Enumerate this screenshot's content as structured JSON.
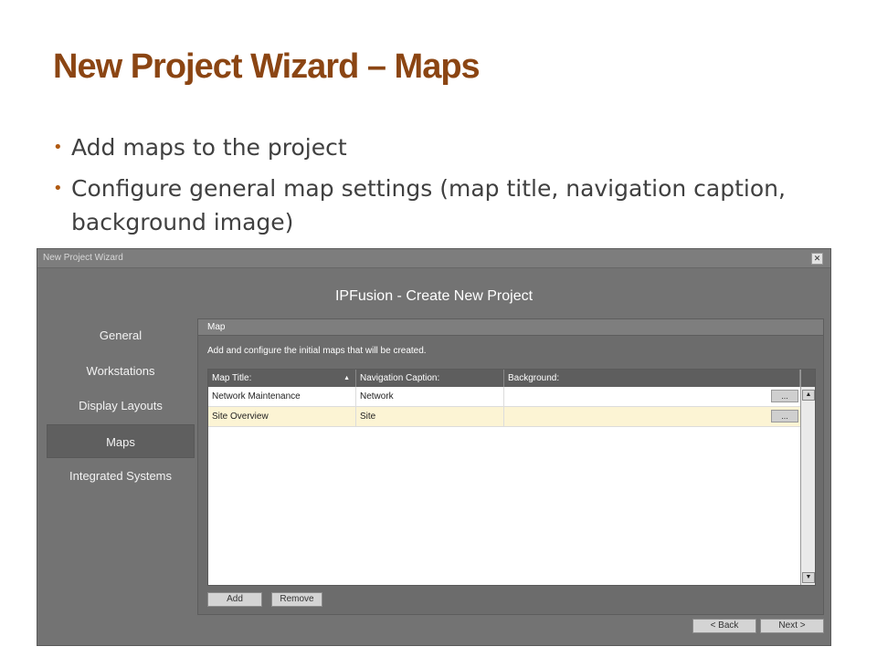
{
  "slide": {
    "title": "New Project Wizard – Maps",
    "bullets": [
      "Add maps to the project",
      "Configure general map settings (map title, navigation caption, background image)"
    ]
  },
  "window": {
    "title": "New Project Wizard",
    "close_glyph": "✕",
    "app_title": "IPFusion - Create New Project"
  },
  "nav": {
    "items": [
      {
        "label": "General"
      },
      {
        "label": "Workstations"
      },
      {
        "label": "Display Layouts"
      },
      {
        "label": "Maps",
        "active": true
      },
      {
        "label": "Integrated Systems"
      }
    ]
  },
  "panel": {
    "header": "Map",
    "description": "Add and configure the initial maps that will be created."
  },
  "grid": {
    "columns": [
      "Map Title:",
      "Navigation Caption:",
      "Background:"
    ],
    "sort_indicator": "▲",
    "ellipsis": "...",
    "scroll_up": "▲",
    "scroll_down": "▼",
    "rows": [
      {
        "title": "Network Maintenance",
        "caption": "Network",
        "background": ""
      },
      {
        "title": "Site Overview",
        "caption": "Site",
        "background": "",
        "selected": true
      }
    ]
  },
  "buttons": {
    "add": "Add",
    "remove": "Remove",
    "back": "< Back",
    "next": "Next >"
  },
  "colors": {
    "title": "#8b4513",
    "bullet": "#b05a12",
    "window_bg": "#737373",
    "selected_row": "#fcf4d4"
  }
}
